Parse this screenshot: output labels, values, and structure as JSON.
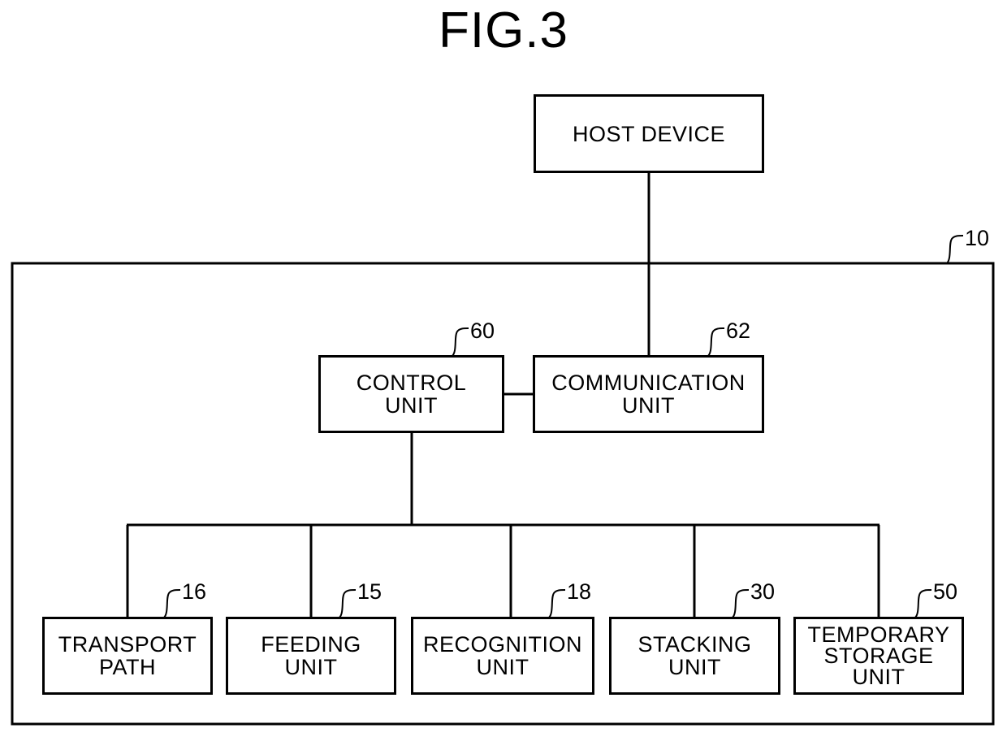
{
  "figure": {
    "title": "FIG.3"
  },
  "host": {
    "label": "HOST DEVICE"
  },
  "system": {
    "ref": "10"
  },
  "control": {
    "label": "CONTROL\nUNIT",
    "ref": "60"
  },
  "communication": {
    "label": "COMMUNICATION\nUNIT",
    "ref": "62"
  },
  "units": [
    {
      "label": "TRANSPORT\nPATH",
      "ref": "16"
    },
    {
      "label": "FEEDING\nUNIT",
      "ref": "15"
    },
    {
      "label": "RECOGNITION\nUNIT",
      "ref": "18"
    },
    {
      "label": "STACKING\nUNIT",
      "ref": "30"
    },
    {
      "label": "TEMPORARY\nSTORAGE\nUNIT",
      "ref": "50"
    }
  ]
}
